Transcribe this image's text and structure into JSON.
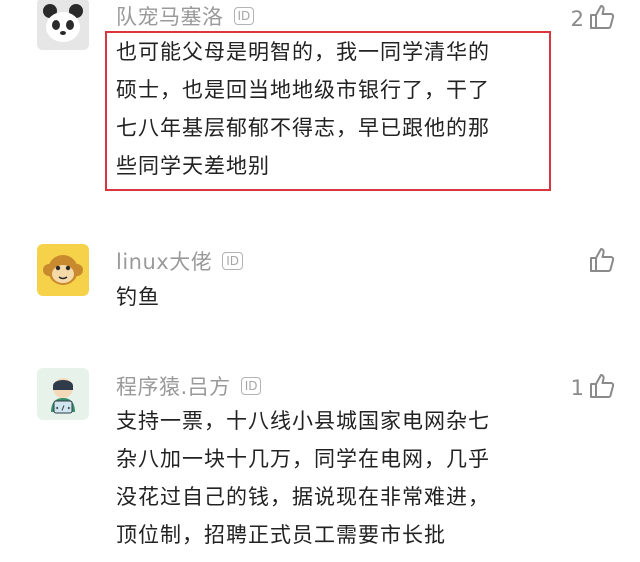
{
  "comments": [
    {
      "username": "队宠马塞洛",
      "id_badge": "ID",
      "avatar_icon": "panda-avatar-icon",
      "like_count": "2",
      "lines": [
        "也可能父母是明智的，我一同学清华的",
        "硕士，也是回当地地级市银行了，干了",
        "七八年基层郁郁不得志，早已跟他的那",
        "些同学天差地别"
      ],
      "highlighted": true
    },
    {
      "username": "linux大佬",
      "id_badge": "ID",
      "avatar_icon": "monkey-avatar-icon",
      "like_count": "",
      "lines": [
        "钓鱼"
      ],
      "highlighted": false
    },
    {
      "username": "程序猿.吕方",
      "id_badge": "ID",
      "avatar_icon": "programmer-avatar-icon",
      "like_count": "1",
      "lines": [
        "支持一票，十八线小县城国家电网杂七",
        "杂八加一块十几万，同学在电网，几乎",
        "没花过自己的钱，据说现在非常难进，",
        "顶位制，招聘正式员工需要市长批"
      ],
      "highlighted": false
    }
  ],
  "colors": {
    "highlight_border": "#d9363e",
    "username": "#9a9a9a",
    "body_text": "#222222"
  }
}
